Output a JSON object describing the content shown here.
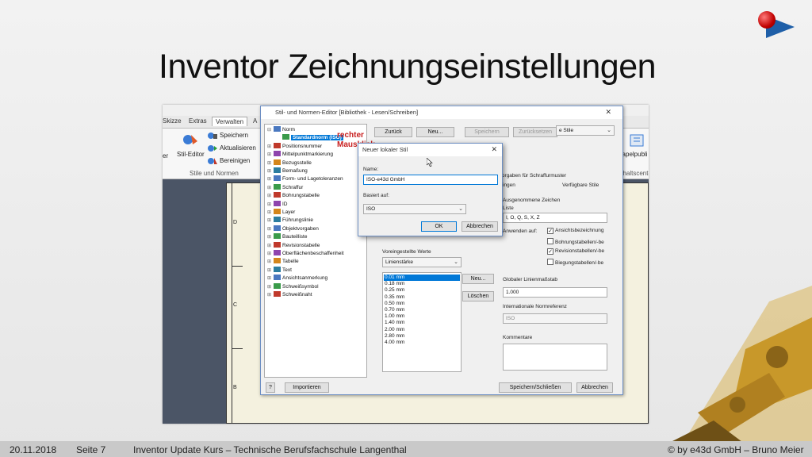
{
  "slide": {
    "title": "Inventor Zeichnungseinstellungen",
    "footer": {
      "date": "20.11.2018",
      "page": "Seite 7",
      "course": "Inventor Update Kurs – Technische Berufsfachschule Langenthal",
      "copyright": "© by e43d GmbH – Bruno Meier"
    },
    "annotation": [
      "rechter",
      "Mausklick"
    ]
  },
  "ribbon": {
    "tabs": [
      "Skizze",
      "Extras",
      "Verwalten",
      "A"
    ],
    "active_tab": "Verwalten",
    "buttons": {
      "stil_editor": "Stil-Editor",
      "speichern": "Speichern",
      "aktualisieren": "Aktualisieren",
      "bereinigen": "Bereinigen",
      "group": "Stile und Normen",
      "stapel": "Stapelpubli",
      "inhalt": "nhaltscente",
      "left_stub": "er"
    }
  },
  "sheet_letters": [
    "D",
    "C",
    "B"
  ],
  "editor": {
    "title": "Stil- und Normen-Editor [Bibliothek - Lesen/Schreiben]",
    "toolbar": {
      "zurueck": "Zurück",
      "neu": "Neu...",
      "speichern": "Speichern",
      "zuruecksetzen": "Zurücksetzen",
      "filter": "e Stile"
    },
    "tree": [
      {
        "label": "Norm",
        "expander": "⊟"
      },
      {
        "label": "Standardnorm (ISO)",
        "expander": "",
        "selected": true
      },
      {
        "label": "Positionsnummer",
        "expander": "⊞"
      },
      {
        "label": "Mittelpunktmarkierung",
        "expander": "⊞"
      },
      {
        "label": "Bezugsstelle",
        "expander": "⊞"
      },
      {
        "label": "Bemaßung",
        "expander": "⊞"
      },
      {
        "label": "Form- und Lagetoleranzen",
        "expander": "⊞"
      },
      {
        "label": "Schraffur",
        "expander": "⊞"
      },
      {
        "label": "Bohrungstabelle",
        "expander": "⊞"
      },
      {
        "label": "ID",
        "expander": "⊞"
      },
      {
        "label": "Layer",
        "expander": "⊞"
      },
      {
        "label": "Führungslinie",
        "expander": "⊞"
      },
      {
        "label": "Objektvorgaben",
        "expander": "⊞"
      },
      {
        "label": "Bauteilliste",
        "expander": "⊞"
      },
      {
        "label": "Revisionstabelle",
        "expander": "⊞"
      },
      {
        "label": "Oberflächenbeschaffenheit",
        "expander": "⊞"
      },
      {
        "label": "Tabelle",
        "expander": "⊞"
      },
      {
        "label": "Text",
        "expander": "⊞"
      },
      {
        "label": "Ansichtsanmerkung",
        "expander": "⊞"
      },
      {
        "label": "Schweißsymbol",
        "expander": "⊞"
      },
      {
        "label": "Schweißnaht",
        "expander": "⊞"
      }
    ],
    "right": {
      "tab_left": "rialvorgaben für Schraffurmuster",
      "tab_ingen": "ingen",
      "tab_verf": "Verfügbare Stile",
      "ausgenommen": "Ausgenommene Zeichen",
      "liste_label": "Liste",
      "liste_value": "I, O, Q, S, X, Z",
      "anwenden": "Anwenden auf:",
      "checks": [
        "Ansichtsbezeichnung",
        "Bohrungstabellen/-be",
        "Revisionstabellen/-be",
        "Biegungstabellen/-be"
      ],
      "checked": [
        true,
        false,
        true,
        false
      ],
      "global_label": "Globaler Linienmaßstab",
      "global_value": "1.000",
      "intl_label": "Internationale Normreferenz",
      "intl_value": "ISO",
      "kommentare": "Kommentare"
    },
    "defaults": {
      "label": "Voreingestellte Werte",
      "combo": "Linienstärke",
      "values": [
        "0.01 mm",
        "0.18 mm",
        "0.25 mm",
        "0.35 mm",
        "0.50 mm",
        "0.70 mm",
        "1.00 mm",
        "1.40 mm",
        "2.00 mm",
        "2.80 mm",
        "4.00 mm"
      ],
      "neu": "Neu...",
      "loeschen": "Löschen"
    },
    "bottom": {
      "importieren": "Importieren",
      "speichern_schliessen": "Speichern/Schließen",
      "abbrechen": "Abbrechen",
      "help": "?"
    }
  },
  "new_style": {
    "title": "Neuer lokaler Stil",
    "name_label": "Name:",
    "name_value": "ISO-e43d GmbH",
    "based_label": "Basiert auf:",
    "based_value": "ISO",
    "ok": "OK",
    "cancel": "Abbrechen"
  }
}
